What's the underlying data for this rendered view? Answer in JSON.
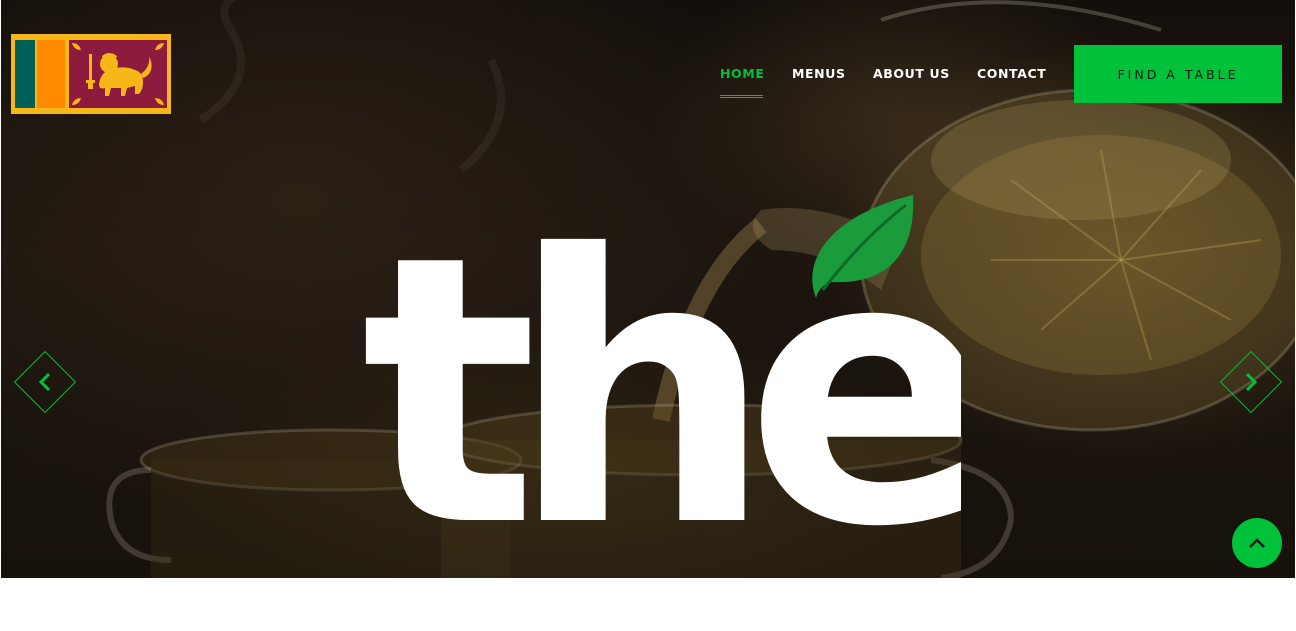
{
  "logo": {
    "alt": "Sri Lanka flag logo"
  },
  "nav": {
    "items": [
      {
        "label": "HOME",
        "active": true
      },
      {
        "label": "MENUS",
        "active": false
      },
      {
        "label": "ABOUT US",
        "active": false
      },
      {
        "label": "CONTACT",
        "active": false
      }
    ],
    "cta_label": "FIND A TABLE"
  },
  "hero": {
    "headline": "the",
    "prev_icon": "chevron-left-icon",
    "next_icon": "chevron-right-icon"
  },
  "back_to_top": {
    "icon": "chevron-up-icon"
  },
  "colors": {
    "accent": "#00c23a",
    "hero_bg": "#17110c",
    "text_light": "#ffffff",
    "flag_gold": "#f7b718",
    "flag_maroon": "#8d1b3d",
    "flag_green": "#005f56",
    "flag_orange": "#ff8a00"
  }
}
